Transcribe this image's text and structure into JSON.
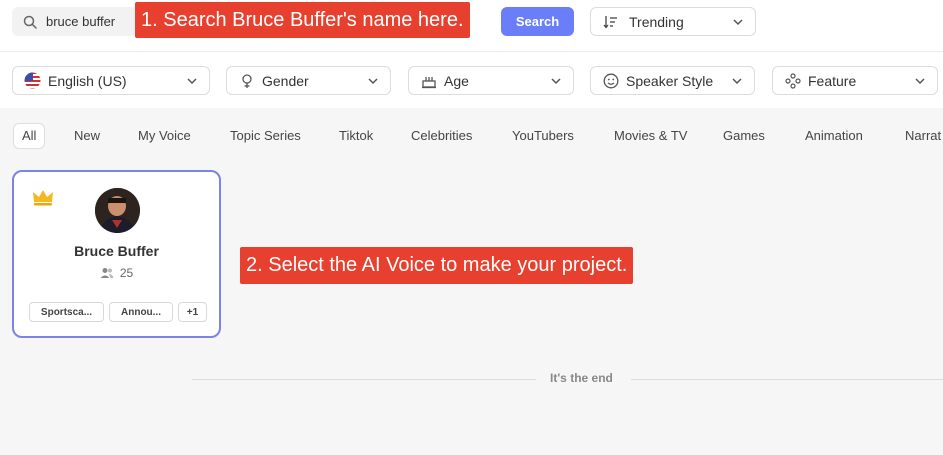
{
  "search": {
    "value": "bruce buffer",
    "button_label": "Search"
  },
  "sort": {
    "selected": "Trending"
  },
  "filters": [
    {
      "label": "English (US)",
      "icon": "us-flag-icon"
    },
    {
      "label": "Gender",
      "icon": "gender-icon"
    },
    {
      "label": "Age",
      "icon": "cake-icon"
    },
    {
      "label": "Speaker Style",
      "icon": "smile-icon"
    },
    {
      "label": "Feature",
      "icon": "feature-icon"
    }
  ],
  "tabs": [
    "All",
    "New",
    "My Voice",
    "Topic Series",
    "Tiktok",
    "Celebrities",
    "YouTubers",
    "Movies & TV",
    "Games",
    "Animation",
    "Narrat"
  ],
  "active_tab": "All",
  "voice_card": {
    "name": "Bruce Buffer",
    "count": "25",
    "tags": [
      "Sportsca...",
      "Annou...",
      "+1"
    ],
    "premium": true
  },
  "callouts": {
    "step1": "1. Search Bruce Buffer's name here.",
    "step2": "2. Select the AI Voice to make your project."
  },
  "end_text": "It's the end",
  "colors": {
    "accent": "#6b7ef9",
    "card_border": "#7b82e8",
    "callout": "#e8402f",
    "crown": "#f5b820"
  }
}
